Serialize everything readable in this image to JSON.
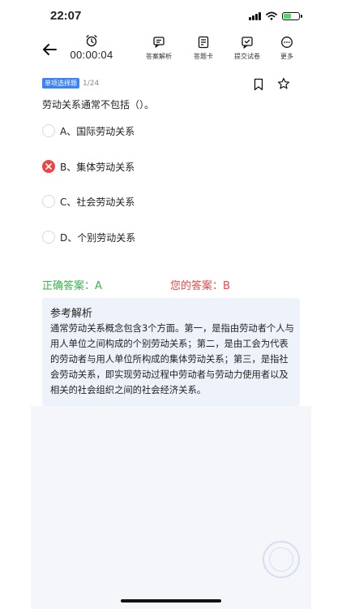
{
  "status_bar": {
    "time": "22:07"
  },
  "toolbar": {
    "timer": "00:00:04",
    "tools": [
      {
        "label": "答案解析",
        "icon": "answer-analysis-icon"
      },
      {
        "label": "答题卡",
        "icon": "answer-sheet-icon"
      },
      {
        "label": "提交试卷",
        "icon": "submit-paper-icon"
      },
      {
        "label": "更多",
        "icon": "more-icon"
      }
    ]
  },
  "question": {
    "type_badge": "单项选择题",
    "progress": "1/24",
    "text": "劳动关系通常不包括（）。",
    "options": [
      {
        "text": "A、国际劳动关系",
        "state": "unselected"
      },
      {
        "text": "B、集体劳动关系",
        "state": "wrong"
      },
      {
        "text": "C、社会劳动关系",
        "state": "unselected"
      },
      {
        "text": "D、个别劳动关系",
        "state": "unselected"
      }
    ]
  },
  "answers": {
    "correct": "正确答案：A",
    "yours": "您的答案：B"
  },
  "analysis": {
    "title": "参考解析",
    "body": "通常劳动关系概念包含3个方面。第一，是指由劳动者个人与用人单位之间构成的个别劳动关系；第二，是由工会为代表的劳动者与用人单位所构成的集体劳动关系；第三，是指社会劳动关系，即实现劳动过程中劳动者与劳动力使用者以及相关的社会组织之间的社会经济关系。"
  },
  "colors": {
    "badge": "#3b82f6",
    "correct": "#38b24a",
    "wrong": "#ef4444",
    "analysis_bg": "#eef3fb"
  }
}
